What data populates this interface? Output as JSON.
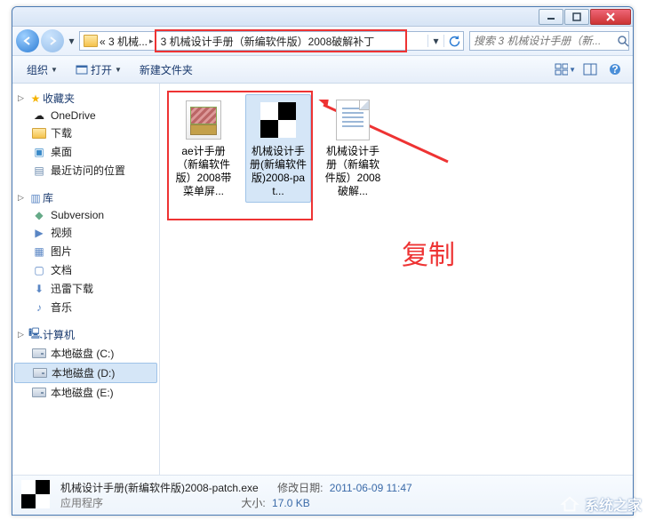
{
  "breadcrumb": {
    "first": "« 3 机械...",
    "second": "3 机械设计手册（新编软件版）2008破解补丁"
  },
  "search": {
    "placeholder": "搜索 3 机械设计手册（新..."
  },
  "toolbar": {
    "organize": "组织",
    "open": "打开",
    "newfolder": "新建文件夹"
  },
  "sidebar": {
    "favorites": "收藏夹",
    "fav_items": [
      "OneDrive",
      "下载",
      "桌面",
      "最近访问的位置"
    ],
    "libraries": "库",
    "lib_items": [
      "Subversion",
      "视频",
      "图片",
      "文档",
      "迅雷下载",
      "音乐"
    ],
    "computer": "计算机",
    "cp_items": [
      "本地磁盘 (C:)",
      "本地磁盘 (D:)",
      "本地磁盘 (E:)"
    ]
  },
  "files": [
    {
      "name": "ae计手册（新编软件版）2008带菜单屏..."
    },
    {
      "name": "机械设计手册(新编软件版)2008-pat..."
    },
    {
      "name": "机械设计手册（新编软件版）2008破解..."
    }
  ],
  "annotation": "复制",
  "status": {
    "name": "机械设计手册(新编软件版)2008-patch.exe",
    "type": "应用程序",
    "date_label": "修改日期:",
    "date": "2011-06-09 11:47",
    "size_label": "大小:",
    "size": "17.0 KB"
  },
  "watermark": "系统之家"
}
